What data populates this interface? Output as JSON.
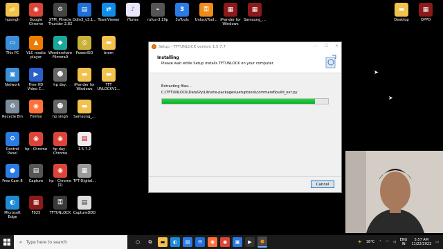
{
  "desktop": {
    "icons": [
      {
        "label": "hpsingh",
        "glyph": "📁",
        "bg": "#f2c14e"
      },
      {
        "label": "Google\nChrome",
        "glyph": "◉",
        "bg": "#db4437"
      },
      {
        "label": "XTM_Miracle\nThunder 2.82",
        "glyph": "⚙",
        "bg": "#444"
      },
      {
        "label": "Odin3_v3.1...",
        "glyph": "▤",
        "bg": "#1e6fd9"
      },
      {
        "label": "TeamViewer",
        "glyph": "⇄",
        "bg": "#0e8ee9"
      },
      {
        "label": "iTunes",
        "glyph": "♪",
        "bg": "#e8e8f8"
      },
      {
        "label": "rufus-3.19p",
        "glyph": "⌁",
        "bg": "#555"
      },
      {
        "label": "3uTools",
        "glyph": "3",
        "bg": "#2a7be4"
      },
      {
        "label": "UnlockTool...",
        "glyph": "⚿",
        "bg": "#f08a18"
      },
      {
        "label": "iPwnder for\nWindows",
        "glyph": "▦",
        "bg": "#8b1a1a"
      },
      {
        "label": "Samsung_...",
        "glyph": "▦",
        "bg": "#8b1a1a"
      },
      {
        "label": "This PC",
        "glyph": "▭",
        "bg": "#3b8fd8"
      },
      {
        "label": "VLC media\nplayer",
        "glyph": "▲",
        "bg": "#ee7a00"
      },
      {
        "label": "Wondershare\nFilmora9",
        "glyph": "◆",
        "bg": "#1aa89c"
      },
      {
        "label": "PowerISO",
        "glyph": "◎",
        "bg": "#c9b037"
      },
      {
        "label": "brom",
        "glyph": "📁",
        "bg": "#f2c14e"
      },
      {
        "label": "Network",
        "glyph": "🖧",
        "bg": "#3b8fd8"
      },
      {
        "label": "Free HD\nVideo C...",
        "glyph": "▶",
        "bg": "#2a60c8"
      },
      {
        "label": "hp day,",
        "glyph": "☻",
        "bg": "#666"
      },
      {
        "label": "iPwnder for\nWindows",
        "glyph": "📁",
        "bg": "#f2c14e"
      },
      {
        "label": "TFT\nUNLOCKV1...",
        "glyph": "📁",
        "bg": "#f2c14e"
      },
      {
        "label": "Recycle Bin",
        "glyph": "🗑",
        "bg": "#7c8b99"
      },
      {
        "label": "Firefox",
        "glyph": "◉",
        "bg": "#ff7139"
      },
      {
        "label": "hp singh",
        "glyph": "☻",
        "bg": "#666"
      },
      {
        "label": "Samsung_...",
        "glyph": "📁",
        "bg": "#f2c14e"
      },
      {
        "label": "Control\nPanel",
        "glyph": "⚙",
        "bg": "#2a7be4"
      },
      {
        "label": "hp - Chrome",
        "glyph": "◉",
        "bg": "#db4437"
      },
      {
        "label": "hp day -\nChrome",
        "glyph": "◉",
        "bg": "#db4437"
      },
      {
        "label": "1.5.7.2",
        "glyph": "▤",
        "bg": "#eee"
      },
      {
        "label": "Free Cam 8",
        "glyph": "●",
        "bg": "#2a7be4"
      },
      {
        "label": "Capture",
        "glyph": "▤",
        "bg": "#555"
      },
      {
        "label": "hp - Chrome\n(1)",
        "glyph": "◉",
        "bg": "#db4437"
      },
      {
        "label": "TFT-Digital...",
        "glyph": "▦",
        "bg": "#999"
      },
      {
        "label": "Microsoft\nEdge",
        "glyph": "◐",
        "bg": "#1e8ad6"
      },
      {
        "label": "F025",
        "glyph": "▦",
        "bg": "#8b1a1a"
      },
      {
        "label": "TFTUNLOCK",
        "glyph": "⚿",
        "bg": "#3a3a3a"
      },
      {
        "label": "CaptureDDD",
        "glyph": "▤",
        "bg": "#ddd"
      },
      {
        "label": "Desktop",
        "glyph": "📁",
        "bg": "#f2c14e"
      },
      {
        "label": "OPPO",
        "glyph": "▦",
        "bg": "#8b1a1a"
      }
    ]
  },
  "setup_window": {
    "title": "Setup - TFTUNLOCK version 1.5.7.7",
    "heading": "Installing",
    "subheading": "Please wait while Setup installs TFTUNLOCK on your computer.",
    "status": "Extracting files...",
    "path": "C:\\TFTUNLOCK\\Data\\Py\\Lib\\site-packages\\setuptools\\command\\build_ext.py",
    "progress_percent": 92,
    "cancel_label": "Cancel",
    "accent": "#06b025"
  },
  "taskbar": {
    "search_placeholder": "Type here to search",
    "weather": "18°C",
    "lang_top": "ENG",
    "lang_bottom": "IN",
    "time": "5:57 AM",
    "date": "11/22/2022"
  }
}
